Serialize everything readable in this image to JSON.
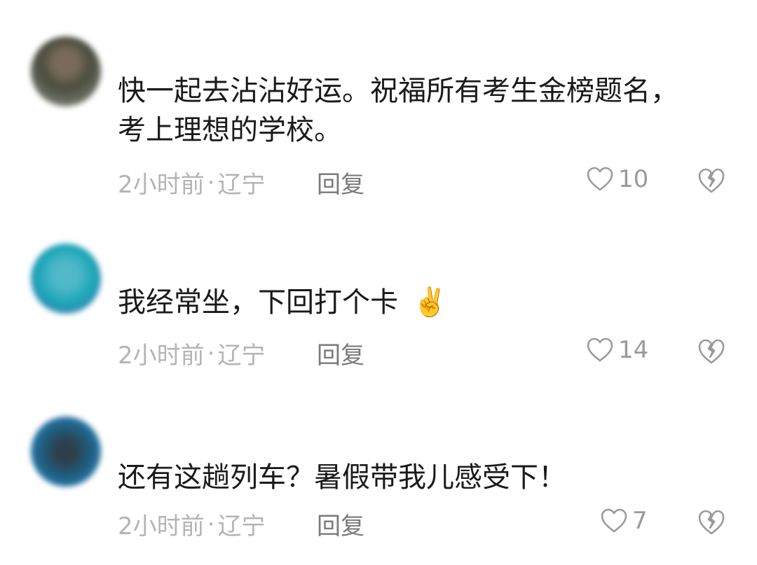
{
  "comments": [
    {
      "username": "",
      "text_line1": "快一起去沾沾好运。祝福所有考生金榜题名，",
      "text_line2": "考上理想的学校。",
      "time": "2小时前",
      "separator": "·",
      "location": "辽宁",
      "reply_label": "回复",
      "likes": "10"
    },
    {
      "username": "",
      "text_line1": "我经常坐，下回打个卡",
      "emoji": "✌️",
      "time": "2小时前",
      "separator": "·",
      "location": "辽宁",
      "reply_label": "回复",
      "likes": "14"
    },
    {
      "username": "",
      "text_line1": "还有这趟列车？暑假带我儿感受下！",
      "time": "2小时前",
      "separator": "·",
      "location": "辽宁",
      "reply_label": "回复",
      "likes": "7"
    }
  ],
  "icons": {
    "like": "heart-outline-icon",
    "dislike": "broken-heart-icon"
  },
  "colors": {
    "meta_text": "#b4b4b4",
    "reply_text": "#7a7a7a",
    "icon_gray": "#9a9a9a"
  }
}
